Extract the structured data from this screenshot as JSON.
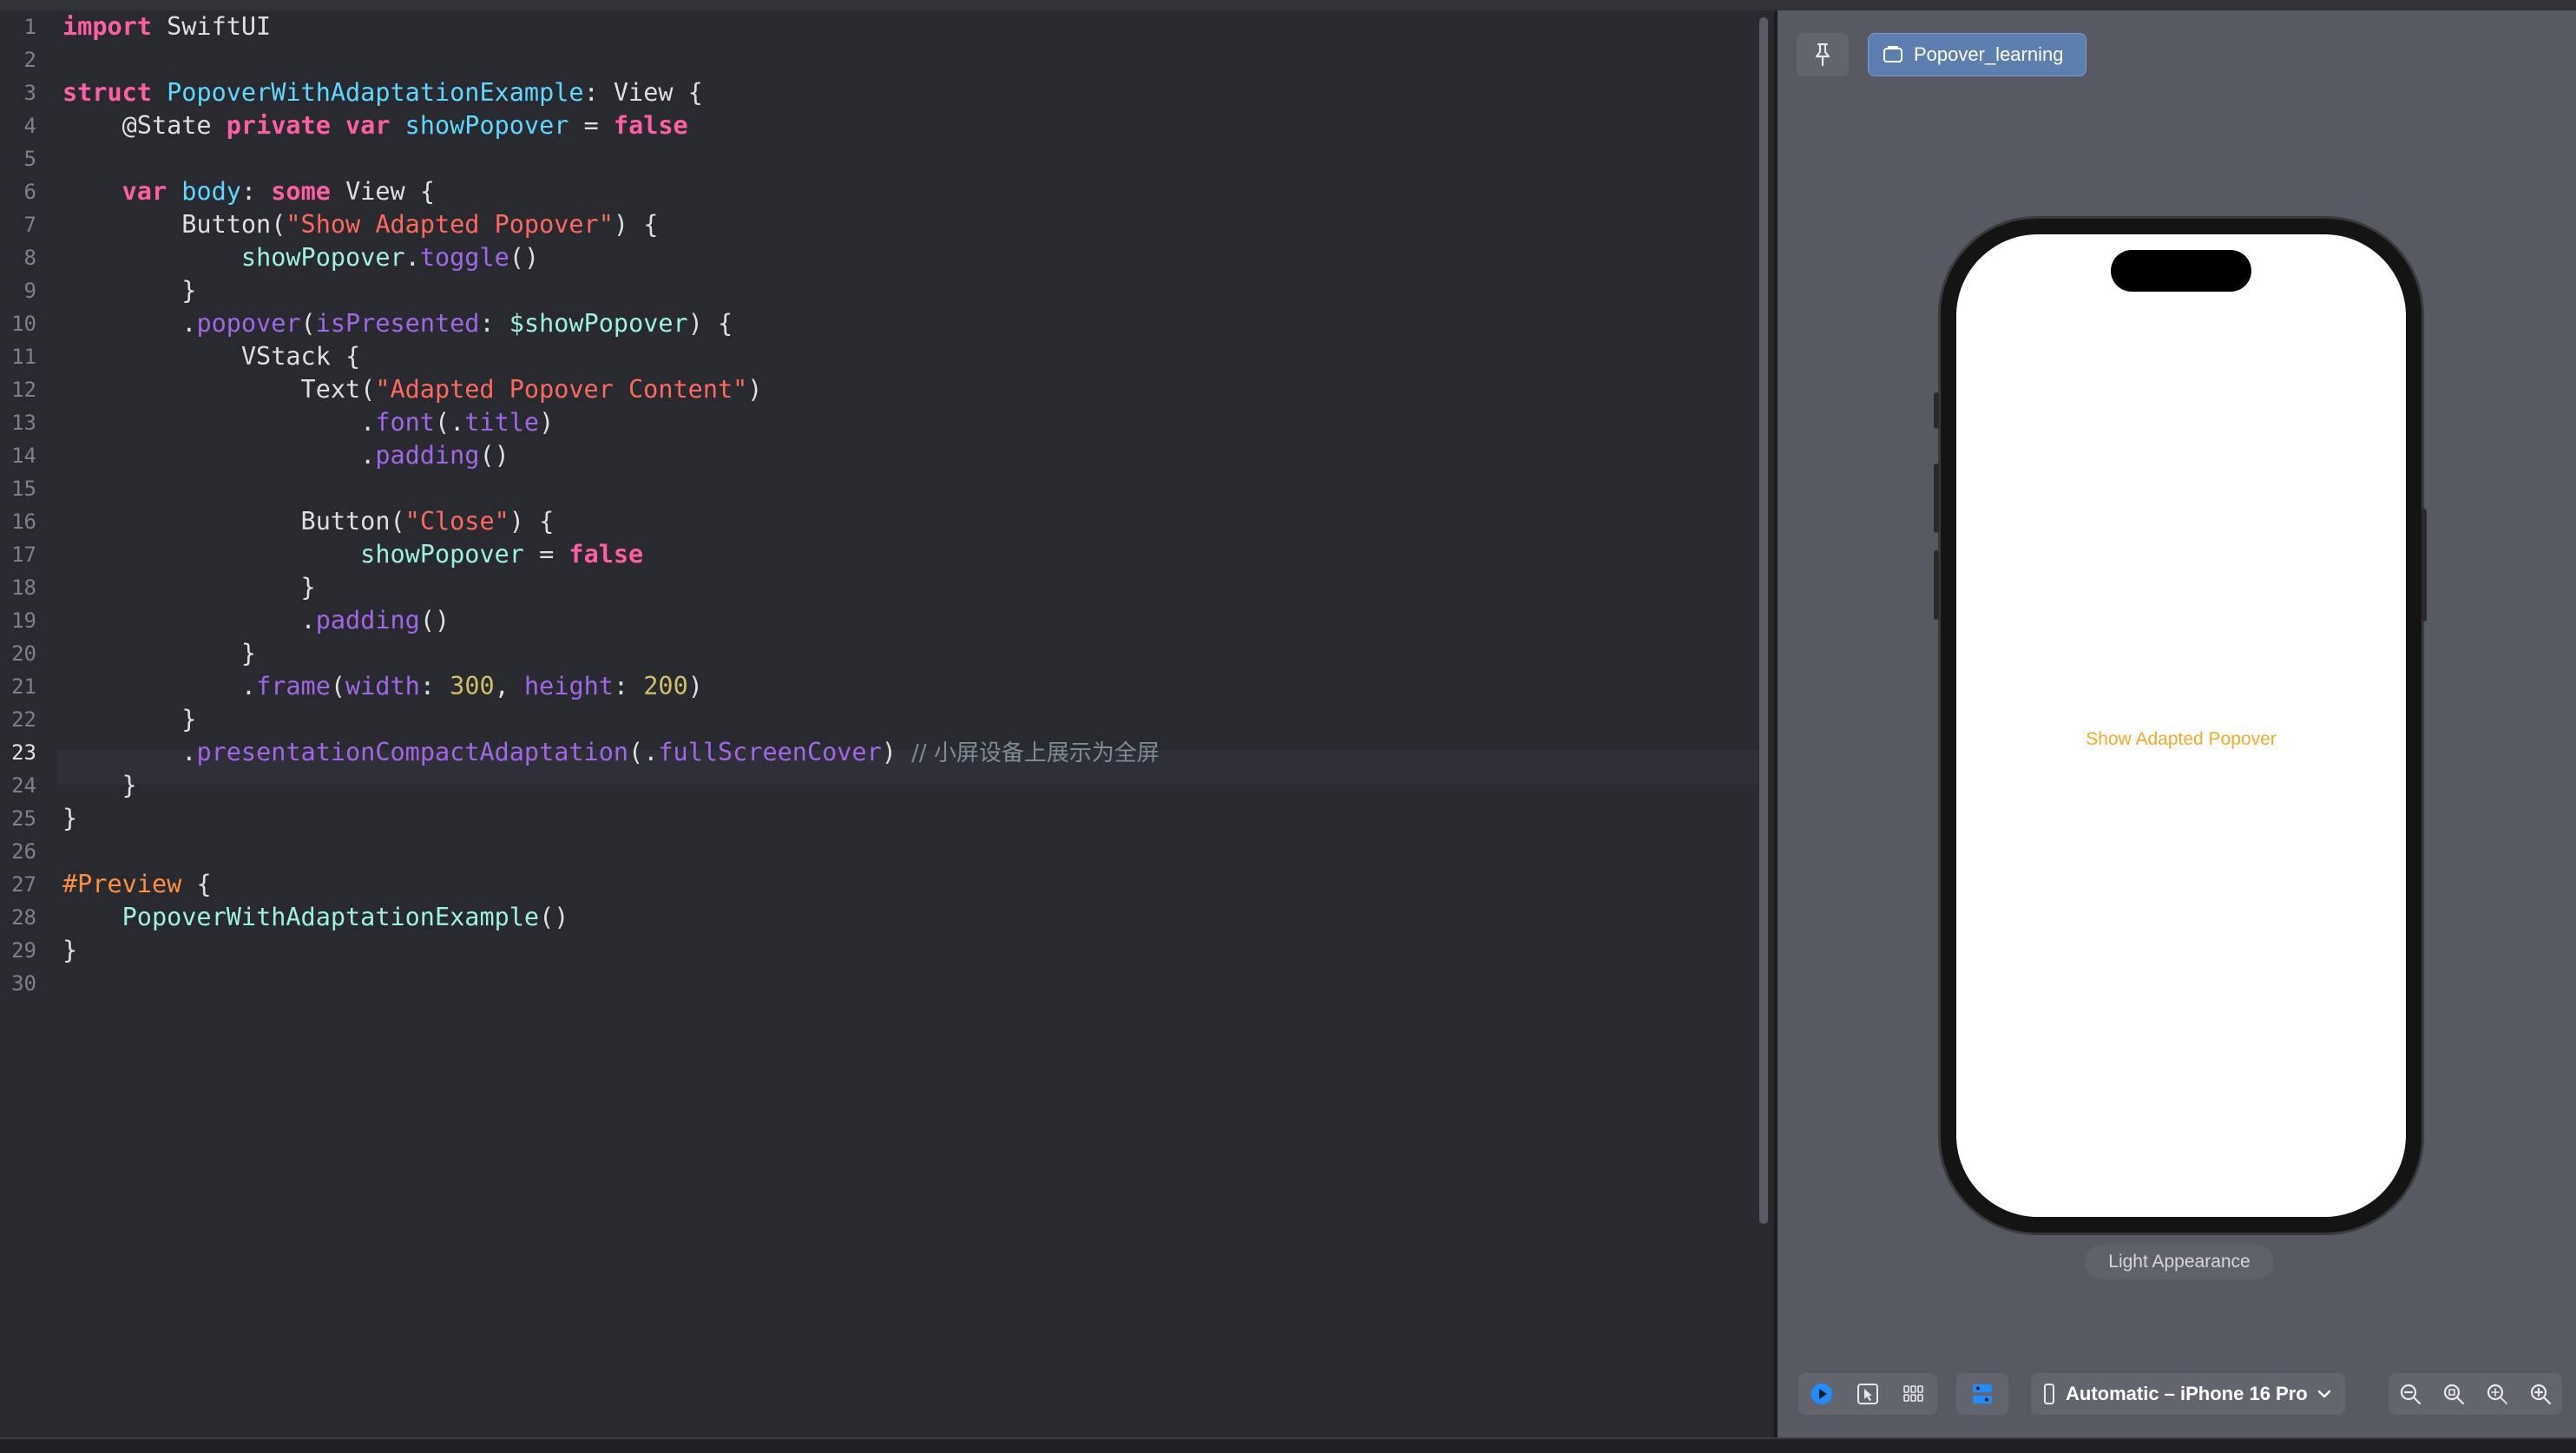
{
  "editor": {
    "active_line": "23",
    "lines": [
      {
        "n": "1",
        "spans": [
          {
            "c": "kw",
            "t": "import"
          },
          {
            "c": "pl",
            "t": " SwiftUI"
          }
        ]
      },
      {
        "n": "2",
        "spans": []
      },
      {
        "n": "3",
        "spans": [
          {
            "c": "kw",
            "t": "struct"
          },
          {
            "c": "pl",
            "t": " "
          },
          {
            "c": "ty",
            "t": "PopoverWithAdaptationExample"
          },
          {
            "c": "pl",
            "t": ": View {"
          }
        ]
      },
      {
        "n": "4",
        "spans": [
          {
            "c": "pl",
            "t": "    @State "
          },
          {
            "c": "kw",
            "t": "private var"
          },
          {
            "c": "pl",
            "t": " "
          },
          {
            "c": "ty",
            "t": "showPopover"
          },
          {
            "c": "pl",
            "t": " = "
          },
          {
            "c": "kw",
            "t": "false"
          }
        ]
      },
      {
        "n": "5",
        "spans": []
      },
      {
        "n": "6",
        "spans": [
          {
            "c": "pl",
            "t": "    "
          },
          {
            "c": "kw",
            "t": "var"
          },
          {
            "c": "pl",
            "t": " "
          },
          {
            "c": "ty",
            "t": "body"
          },
          {
            "c": "pl",
            "t": ": "
          },
          {
            "c": "kw",
            "t": "some"
          },
          {
            "c": "pl",
            "t": " View {"
          }
        ]
      },
      {
        "n": "7",
        "spans": [
          {
            "c": "pl",
            "t": "        Button("
          },
          {
            "c": "st",
            "t": "\"Show Adapted Popover\""
          },
          {
            "c": "pl",
            "t": ") {"
          }
        ]
      },
      {
        "n": "8",
        "spans": [
          {
            "c": "pl",
            "t": "            "
          },
          {
            "c": "cls",
            "t": "showPopover"
          },
          {
            "c": "pl",
            "t": "."
          },
          {
            "c": "fn",
            "t": "toggle"
          },
          {
            "c": "pl",
            "t": "()"
          }
        ]
      },
      {
        "n": "9",
        "spans": [
          {
            "c": "pl",
            "t": "        }"
          }
        ]
      },
      {
        "n": "10",
        "spans": [
          {
            "c": "pl",
            "t": "        ."
          },
          {
            "c": "fn",
            "t": "popover"
          },
          {
            "c": "pl",
            "t": "("
          },
          {
            "c": "fn",
            "t": "isPresented"
          },
          {
            "c": "pl",
            "t": ": "
          },
          {
            "c": "cls",
            "t": "$showPopover"
          },
          {
            "c": "pl",
            "t": ") {"
          }
        ]
      },
      {
        "n": "11",
        "spans": [
          {
            "c": "pl",
            "t": "            VStack {"
          }
        ]
      },
      {
        "n": "12",
        "spans": [
          {
            "c": "pl",
            "t": "                Text("
          },
          {
            "c": "st",
            "t": "\"Adapted Popover Content\""
          },
          {
            "c": "pl",
            "t": ")"
          }
        ]
      },
      {
        "n": "13",
        "spans": [
          {
            "c": "pl",
            "t": "                    ."
          },
          {
            "c": "fn",
            "t": "font"
          },
          {
            "c": "pl",
            "t": "(."
          },
          {
            "c": "fn",
            "t": "title"
          },
          {
            "c": "pl",
            "t": ")"
          }
        ]
      },
      {
        "n": "14",
        "spans": [
          {
            "c": "pl",
            "t": "                    ."
          },
          {
            "c": "fn",
            "t": "padding"
          },
          {
            "c": "pl",
            "t": "()"
          }
        ]
      },
      {
        "n": "15",
        "spans": []
      },
      {
        "n": "16",
        "spans": [
          {
            "c": "pl",
            "t": "                Button("
          },
          {
            "c": "st",
            "t": "\"Close\""
          },
          {
            "c": "pl",
            "t": ") {"
          }
        ]
      },
      {
        "n": "17",
        "spans": [
          {
            "c": "pl",
            "t": "                    "
          },
          {
            "c": "cls",
            "t": "showPopover"
          },
          {
            "c": "pl",
            "t": " = "
          },
          {
            "c": "kw",
            "t": "false"
          }
        ]
      },
      {
        "n": "18",
        "spans": [
          {
            "c": "pl",
            "t": "                }"
          }
        ]
      },
      {
        "n": "19",
        "spans": [
          {
            "c": "pl",
            "t": "                ."
          },
          {
            "c": "fn",
            "t": "padding"
          },
          {
            "c": "pl",
            "t": "()"
          }
        ]
      },
      {
        "n": "20",
        "spans": [
          {
            "c": "pl",
            "t": "            }"
          }
        ]
      },
      {
        "n": "21",
        "spans": [
          {
            "c": "pl",
            "t": "            ."
          },
          {
            "c": "fn",
            "t": "frame"
          },
          {
            "c": "pl",
            "t": "("
          },
          {
            "c": "fn",
            "t": "width"
          },
          {
            "c": "pl",
            "t": ": "
          },
          {
            "c": "nm",
            "t": "300"
          },
          {
            "c": "pl",
            "t": ", "
          },
          {
            "c": "fn",
            "t": "height"
          },
          {
            "c": "pl",
            "t": ": "
          },
          {
            "c": "nm",
            "t": "200"
          },
          {
            "c": "pl",
            "t": ")"
          }
        ]
      },
      {
        "n": "22",
        "spans": [
          {
            "c": "pl",
            "t": "        }"
          }
        ]
      },
      {
        "n": "23",
        "spans": [
          {
            "c": "pl",
            "t": "        ."
          },
          {
            "c": "fn",
            "t": "presentationCompactAdaptation"
          },
          {
            "c": "pl",
            "t": "(."
          },
          {
            "c": "fn",
            "t": "fullScreenCover"
          },
          {
            "c": "pl",
            "t": ") "
          },
          {
            "c": "cm",
            "t": "// 小屏设备上展示为全屏"
          }
        ]
      },
      {
        "n": "24",
        "spans": [
          {
            "c": "pl",
            "t": "    }"
          }
        ]
      },
      {
        "n": "25",
        "spans": [
          {
            "c": "pl",
            "t": "}"
          }
        ]
      },
      {
        "n": "26",
        "spans": []
      },
      {
        "n": "27",
        "spans": [
          {
            "c": "pp",
            "t": "#Preview"
          },
          {
            "c": "pl",
            "t": " {"
          }
        ]
      },
      {
        "n": "28",
        "spans": [
          {
            "c": "pl",
            "t": "    "
          },
          {
            "c": "cls",
            "t": "PopoverWithAdaptationExample"
          },
          {
            "c": "pl",
            "t": "()"
          }
        ]
      },
      {
        "n": "29",
        "spans": [
          {
            "c": "pl",
            "t": "}"
          }
        ]
      },
      {
        "n": "30",
        "spans": []
      }
    ]
  },
  "canvas": {
    "scheme_label": "Popover_learning",
    "preview_button_label": "Show Adapted Popover",
    "appearance_label": "Light Appearance",
    "device_picker_label": "Automatic – iPhone 16 Pro"
  },
  "icons": {
    "pin": "pin-icon",
    "scheme": "folder-icon",
    "live": "play-circle-icon",
    "select": "cursor-select-icon",
    "grid": "grid-icon",
    "variants": "variants-icon",
    "device": "iphone-icon",
    "chevron": "chevron-down-icon",
    "zoom_out": "zoom-out-icon",
    "zoom_fit": "zoom-fit-icon",
    "zoom_100": "zoom-actual-icon",
    "zoom_in": "zoom-in-icon"
  },
  "colors": {
    "editor_bg": "#292a30",
    "canvas_bg": "#575a63",
    "keyword": "#fc5fa3",
    "type": "#5dd8ff",
    "string": "#fc6a5d",
    "number": "#d0bf69",
    "accent_button": "#f7a928",
    "live_blue": "#1f8cff"
  }
}
